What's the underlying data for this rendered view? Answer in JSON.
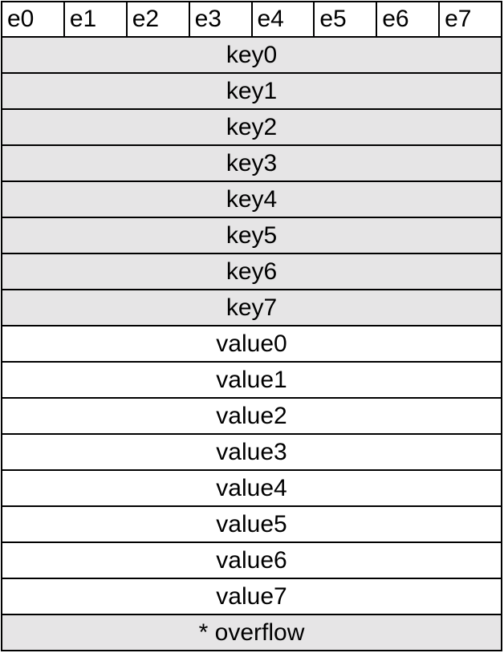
{
  "bucket": {
    "tophash": [
      "e0",
      "e1",
      "e2",
      "e3",
      "e4",
      "e5",
      "e6",
      "e7"
    ],
    "keys": [
      "key0",
      "key1",
      "key2",
      "key3",
      "key4",
      "key5",
      "key6",
      "key7"
    ],
    "values": [
      "value0",
      "value1",
      "value2",
      "value3",
      "value4",
      "value5",
      "value6",
      "value7"
    ],
    "overflow": "* overflow"
  },
  "colors": {
    "shaded_fill": "#e6e5e6",
    "plain_fill": "#ffffff",
    "border": "#000000"
  }
}
